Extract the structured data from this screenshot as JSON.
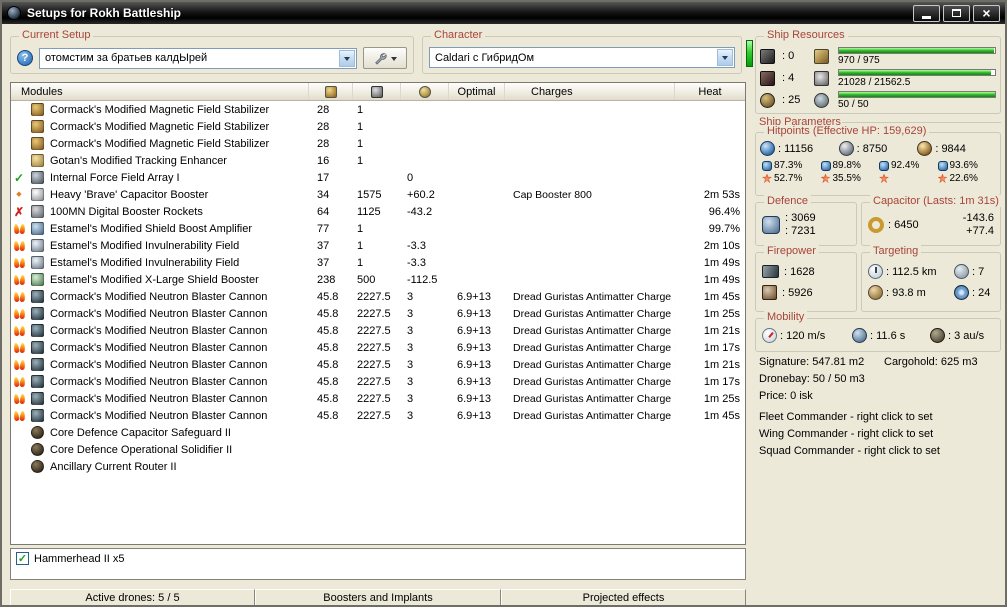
{
  "window": {
    "title": "Setups for Rokh Battleship"
  },
  "current_setup": {
    "label": "Current Setup",
    "combo_value": "отомстим за братьев калдЫрей"
  },
  "character": {
    "label": "Character",
    "combo_value": "Caldari с ГибридОм"
  },
  "ship_resources": {
    "label": "Ship Resources",
    "hardpoints": [
      {
        "icon": "turret-hardpoints-icon",
        "value": ": 0"
      },
      {
        "icon": "launcher-hardpoints-icon",
        "value": ": 4"
      },
      {
        "icon": "calibration-icon",
        "value": ": 25"
      }
    ],
    "bars": [
      {
        "icon": "cpu-icon",
        "text": "970 / 975",
        "pct": 99.5
      },
      {
        "icon": "powergrid-icon",
        "text": "21028 / 21562.5",
        "pct": 97.5
      },
      {
        "icon": "drone-bandwidth-icon",
        "text": "50 / 50",
        "pct": 100
      }
    ]
  },
  "modules_table": {
    "header": {
      "modules": "Modules",
      "optimal": "Optimal",
      "charges": "Charges",
      "heat": "Heat"
    },
    "rows": [
      {
        "status": "",
        "icon": "magstab",
        "name": "Cormack's Modified Magnetic Field Stabilizer",
        "cpu": "28",
        "pg": "1",
        "cap": "",
        "optimal": "",
        "charges": "",
        "heat": ""
      },
      {
        "status": "",
        "icon": "magstab",
        "name": "Cormack's Modified Magnetic Field Stabilizer",
        "cpu": "28",
        "pg": "1",
        "cap": "",
        "optimal": "",
        "charges": "",
        "heat": ""
      },
      {
        "status": "",
        "icon": "magstab",
        "name": "Cormack's Modified Magnetic Field Stabilizer",
        "cpu": "28",
        "pg": "1",
        "cap": "",
        "optimal": "",
        "charges": "",
        "heat": ""
      },
      {
        "status": "",
        "icon": "tracking",
        "name": "Gotan's Modified Tracking Enhancer",
        "cpu": "16",
        "pg": "1",
        "cap": "",
        "optimal": "",
        "charges": "",
        "heat": ""
      },
      {
        "status": "check",
        "icon": "forcefield",
        "name": "Internal Force Field Array I",
        "cpu": "17",
        "pg": "",
        "cap": "0",
        "optimal": "",
        "charges": "",
        "heat": ""
      },
      {
        "status": "diamond",
        "icon": "capbooster",
        "name": "Heavy 'Brave' Capacitor Booster",
        "cpu": "34",
        "pg": "1575",
        "cap": "+60.2",
        "optimal": "",
        "charges": "Cap Booster 800",
        "heat": "2m 53s"
      },
      {
        "status": "cross",
        "icon": "rockets",
        "name": "100MN Digital Booster Rockets",
        "cpu": "64",
        "pg": "1125",
        "cap": "-43.2",
        "optimal": "",
        "charges": "",
        "heat": "96.4%"
      },
      {
        "status": "flame",
        "icon": "shieldamp",
        "name": "Estamel's Modified Shield Boost Amplifier",
        "cpu": "77",
        "pg": "1",
        "cap": "",
        "optimal": "",
        "charges": "",
        "heat": "99.7%"
      },
      {
        "status": "flame",
        "icon": "invuln",
        "name": "Estamel's Modified Invulnerability Field",
        "cpu": "37",
        "pg": "1",
        "cap": "-3.3",
        "optimal": "",
        "charges": "",
        "heat": "2m 10s"
      },
      {
        "status": "flame",
        "icon": "invuln",
        "name": "Estamel's Modified Invulnerability Field",
        "cpu": "37",
        "pg": "1",
        "cap": "-3.3",
        "optimal": "",
        "charges": "",
        "heat": "1m 49s"
      },
      {
        "status": "flame",
        "icon": "xlbooster",
        "name": "Estamel's Modified X-Large Shield Booster",
        "cpu": "238",
        "pg": "500",
        "cap": "-112.5",
        "optimal": "",
        "charges": "",
        "heat": "1m 49s"
      },
      {
        "status": "flame",
        "icon": "blaster",
        "name": "Cormack's Modified Neutron Blaster Cannon",
        "cpu": "45.8",
        "pg": "2227.5",
        "cap": "3",
        "optimal": "6.9+13",
        "charges": "Dread Guristas Antimatter Charge L",
        "heat": "1m 45s"
      },
      {
        "status": "flame",
        "icon": "blaster",
        "name": "Cormack's Modified Neutron Blaster Cannon",
        "cpu": "45.8",
        "pg": "2227.5",
        "cap": "3",
        "optimal": "6.9+13",
        "charges": "Dread Guristas Antimatter Charge L",
        "heat": "1m 25s"
      },
      {
        "status": "flame",
        "icon": "blaster",
        "name": "Cormack's Modified Neutron Blaster Cannon",
        "cpu": "45.8",
        "pg": "2227.5",
        "cap": "3",
        "optimal": "6.9+13",
        "charges": "Dread Guristas Antimatter Charge L",
        "heat": "1m 21s"
      },
      {
        "status": "flame",
        "icon": "blaster",
        "name": "Cormack's Modified Neutron Blaster Cannon",
        "cpu": "45.8",
        "pg": "2227.5",
        "cap": "3",
        "optimal": "6.9+13",
        "charges": "Dread Guristas Antimatter Charge L",
        "heat": "1m 17s"
      },
      {
        "status": "flame",
        "icon": "blaster",
        "name": "Cormack's Modified Neutron Blaster Cannon",
        "cpu": "45.8",
        "pg": "2227.5",
        "cap": "3",
        "optimal": "6.9+13",
        "charges": "Dread Guristas Antimatter Charge L",
        "heat": "1m 21s"
      },
      {
        "status": "flame",
        "icon": "blaster",
        "name": "Cormack's Modified Neutron Blaster Cannon",
        "cpu": "45.8",
        "pg": "2227.5",
        "cap": "3",
        "optimal": "6.9+13",
        "charges": "Dread Guristas Antimatter Charge L",
        "heat": "1m 17s"
      },
      {
        "status": "flame",
        "icon": "blaster",
        "name": "Cormack's Modified Neutron Blaster Cannon",
        "cpu": "45.8",
        "pg": "2227.5",
        "cap": "3",
        "optimal": "6.9+13",
        "charges": "Dread Guristas Antimatter Charge L",
        "heat": "1m 25s"
      },
      {
        "status": "flame",
        "icon": "blaster",
        "name": "Cormack's Modified Neutron Blaster Cannon",
        "cpu": "45.8",
        "pg": "2227.5",
        "cap": "3",
        "optimal": "6.9+13",
        "charges": "Dread Guristas Antimatter Charge L",
        "heat": "1m 45s"
      },
      {
        "status": "",
        "icon": "rig",
        "name": "Core Defence Capacitor Safeguard II",
        "cpu": "",
        "pg": "",
        "cap": "",
        "optimal": "",
        "charges": "",
        "heat": ""
      },
      {
        "status": "",
        "icon": "rig",
        "name": "Core Defence Operational Solidifier II",
        "cpu": "",
        "pg": "",
        "cap": "",
        "optimal": "",
        "charges": "",
        "heat": ""
      },
      {
        "status": "",
        "icon": "rig",
        "name": "Ancillary Current Router II",
        "cpu": "",
        "pg": "",
        "cap": "",
        "optimal": "",
        "charges": "",
        "heat": ""
      }
    ]
  },
  "ship_parameters": {
    "label": "Ship Parameters",
    "hitpoints": {
      "label": "Hitpoints (Effective HP: 159,629)",
      "hp": [
        {
          "icon": "shield-hp-icon",
          "value": ": 11156"
        },
        {
          "icon": "armor-hp-icon",
          "value": ": 8750"
        },
        {
          "icon": "structure-hp-icon",
          "value": ": 9844"
        }
      ],
      "resists": [
        {
          "top": "87.3%",
          "bottom": "52.7%"
        },
        {
          "top": "89.8%",
          "bottom": "35.5%"
        },
        {
          "top": "92.4%",
          "bottom": ""
        },
        {
          "top": "93.6%",
          "bottom": "22.6%"
        }
      ]
    },
    "defence": {
      "label": "Defence",
      "value1": ": 3069",
      "value2": ": 7231"
    },
    "capacitor": {
      "label": "Capacitor (Lasts: 1m 31s)",
      "amount": ": 6450",
      "out": "-143.6",
      "in": "+77.4"
    },
    "firepower": {
      "label": "Firepower",
      "volley": ": 1628",
      "dps": ": 5926"
    },
    "targeting": {
      "label": "Targeting",
      "range": ": 112.5 km",
      "max_targets": ": 7",
      "scan_resolution": ": 93.8 m",
      "sensor_strength": ": 24"
    },
    "mobility": {
      "label": "Mobility",
      "speed": ": 120 m/s",
      "align": ": 11.6 s",
      "warp": ": 3 au/s"
    },
    "info": {
      "signature": "Signature: 547.81 m2",
      "cargohold": "Cargohold: 625 m3",
      "dronebay": "Dronebay: 50 / 50 m3",
      "price": "Price: 0 isk",
      "fleet": "Fleet Commander - right click to set",
      "wing": "Wing Commander - right click to set",
      "squad": "Squad Commander - right click to set"
    }
  },
  "drones_panel": {
    "items": [
      {
        "checked": true,
        "label": "Hammerhead II x5"
      }
    ]
  },
  "bottom_bar": {
    "sections": [
      "Active drones: 5 / 5",
      "Boosters and Implants",
      "Projected effects"
    ]
  }
}
